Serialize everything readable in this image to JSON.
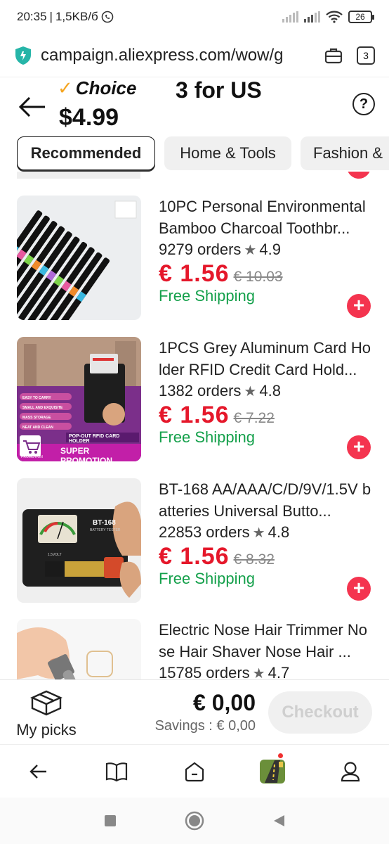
{
  "status_bar": {
    "time": "20:35",
    "separator": "|",
    "network_speed": "1,5KB/б",
    "battery": "26",
    "icons": [
      "whatsapp-icon",
      "signal-icon",
      "signal-icon",
      "wifi-icon",
      "battery-icon"
    ]
  },
  "browser": {
    "url": "campaign.aliexpress.com/wow/g",
    "tab_count": "3",
    "icons": [
      "shield-icon",
      "briefcase-icon",
      "tabs-icon"
    ]
  },
  "header": {
    "choice_label": "Choice",
    "price": "$4.99",
    "promo": "3 for US",
    "help": "?"
  },
  "categories": [
    {
      "label": "Recommended",
      "active": true
    },
    {
      "label": "Home & Tools",
      "active": false
    },
    {
      "label": "Fashion &",
      "active": false
    }
  ],
  "products": [
    {
      "title": "10PC Personal Environmental Bamboo Charcoal Toothbr...",
      "orders": "9279 orders",
      "rating": "4.9",
      "price": "€ 1.56",
      "old_price": "€ 10.03",
      "shipping": "Free Shipping",
      "add": "+"
    },
    {
      "title": "1PCS Grey Aluminum Card Holder RFID Credit Card Hold...",
      "orders": "1382 orders",
      "rating": "4.8",
      "price": "€ 1.56",
      "old_price": "€ 7.22",
      "shipping": "Free Shipping",
      "add": "+",
      "image_text": {
        "features": [
          "EASY TO CARRY",
          "SMALL AND EXQUISITE",
          "MASS STORAGE",
          "NEAT AND CLEAN"
        ],
        "caption": "POP-OUT RFID CARD HOLDER",
        "badge": "SUPER PROMOTION",
        "promo_small": "PROMOTION"
      }
    },
    {
      "title": "BT-168 AA/AAA/C/D/9V/1.5V batteries Universal Butto...",
      "orders": "22853 orders",
      "rating": "4.8",
      "price": "€ 1.56",
      "old_price": "€ 8.32",
      "shipping": "Free Shipping",
      "add": "+",
      "image_text": {
        "model": "BT-168",
        "subtitle": "BATTERY TESTER",
        "voltage": "1.5VOLT"
      }
    },
    {
      "title": "Electric Nose Hair Trimmer Nose Hair Shaver Nose Hair ...",
      "orders": "15785 orders",
      "rating": "4.7"
    }
  ],
  "checkout": {
    "my_picks": "My picks",
    "total": "€ 0,00",
    "savings": "Savings : € 0,00",
    "button": "Checkout"
  },
  "browser_nav": {
    "icons": [
      "back-arrow-icon",
      "book-icon",
      "home-icon",
      "game-icon",
      "profile-icon"
    ]
  },
  "system_nav": {
    "icons": [
      "recents-icon",
      "home-circle-icon",
      "back-triangle-icon"
    ]
  }
}
